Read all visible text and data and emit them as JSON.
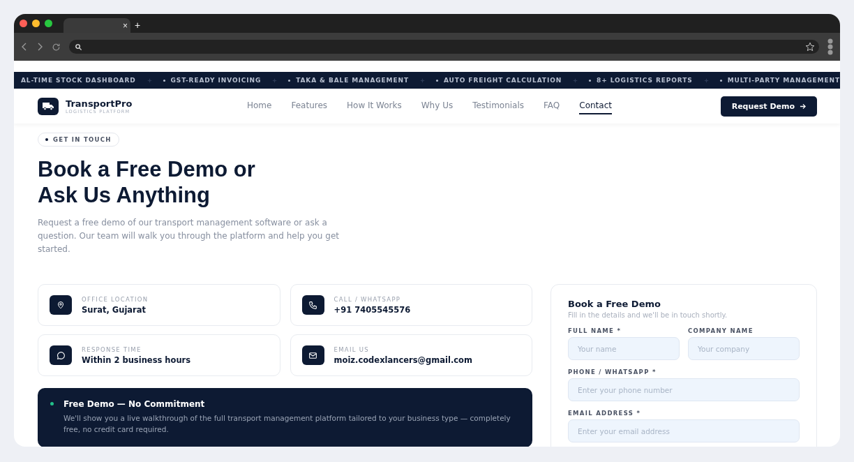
{
  "browser": {
    "tab_close": "×",
    "new_tab": "+"
  },
  "ticker": [
    "AL-TIME STOCK DASHBOARD",
    "GST-READY INVOICING",
    "TAKA & BALE MANAGEMENT",
    "AUTO FREIGHT CALCULATION",
    "8+ LOGISTICS REPORTS",
    "MULTI-PARTY MANAGEMENT"
  ],
  "brand": {
    "name": "TransportPro",
    "tagline": "LOGISTICS PLATFORM"
  },
  "nav": [
    {
      "label": "Home",
      "selected": false
    },
    {
      "label": "Features",
      "selected": false
    },
    {
      "label": "How It Works",
      "selected": false
    },
    {
      "label": "Why Us",
      "selected": false
    },
    {
      "label": "Testimonials",
      "selected": false
    },
    {
      "label": "FAQ",
      "selected": false
    },
    {
      "label": "Contact",
      "selected": true
    }
  ],
  "cta": "Request Demo",
  "hero": {
    "badge": "GET IN TOUCH",
    "title_lines": [
      "Book a Free Demo or",
      "Ask Us Anything"
    ],
    "lead": "Request a free demo of our transport management software or ask a question. Our team will walk you through the platform and help you get started."
  },
  "contacts": [
    {
      "kind": "location",
      "label": "OFFICE LOCATION",
      "value": "Surat, Gujarat"
    },
    {
      "kind": "phone",
      "label": "CALL / WHATSAPP",
      "value": "+91 7405545576"
    },
    {
      "kind": "chat",
      "label": "RESPONSE TIME",
      "value": "Within 2 business hours"
    },
    {
      "kind": "mail",
      "label": "EMAIL US",
      "value": "moiz.codexlancers@gmail.com"
    }
  ],
  "promo": {
    "title": "Free Demo — No Commitment",
    "text": "We'll show you a live walkthrough of the full transport management platform tailored to your business type — completely free, no credit card required."
  },
  "form": {
    "title": "Book a Free Demo",
    "subtitle": "Fill in the details and we'll be in touch shortly.",
    "rows": [
      [
        {
          "label": "FULL NAME *",
          "placeholder": "Your name"
        },
        {
          "label": "COMPANY NAME",
          "placeholder": "Your company"
        }
      ],
      [
        {
          "label": "PHONE / WHATSAPP *",
          "placeholder": "Enter your phone number"
        }
      ],
      [
        {
          "label": "EMAIL ADDRESS *",
          "placeholder": "Enter your email address"
        }
      ]
    ]
  }
}
